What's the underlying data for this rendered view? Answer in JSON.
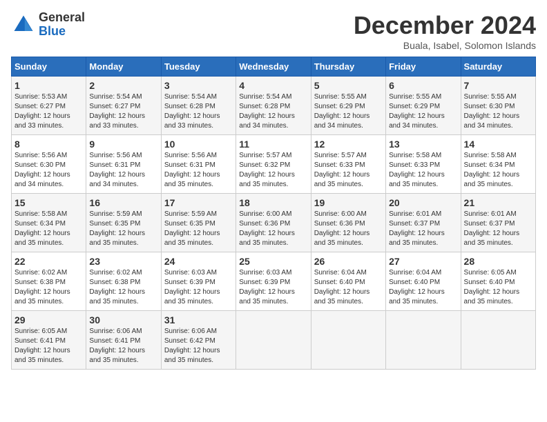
{
  "logo": {
    "general": "General",
    "blue": "Blue"
  },
  "title": "December 2024",
  "subtitle": "Buala, Isabel, Solomon Islands",
  "days_of_week": [
    "Sunday",
    "Monday",
    "Tuesday",
    "Wednesday",
    "Thursday",
    "Friday",
    "Saturday"
  ],
  "weeks": [
    [
      {
        "day": "1",
        "info": "Sunrise: 5:53 AM\nSunset: 6:27 PM\nDaylight: 12 hours\nand 33 minutes."
      },
      {
        "day": "2",
        "info": "Sunrise: 5:54 AM\nSunset: 6:27 PM\nDaylight: 12 hours\nand 33 minutes."
      },
      {
        "day": "3",
        "info": "Sunrise: 5:54 AM\nSunset: 6:28 PM\nDaylight: 12 hours\nand 33 minutes."
      },
      {
        "day": "4",
        "info": "Sunrise: 5:54 AM\nSunset: 6:28 PM\nDaylight: 12 hours\nand 34 minutes."
      },
      {
        "day": "5",
        "info": "Sunrise: 5:55 AM\nSunset: 6:29 PM\nDaylight: 12 hours\nand 34 minutes."
      },
      {
        "day": "6",
        "info": "Sunrise: 5:55 AM\nSunset: 6:29 PM\nDaylight: 12 hours\nand 34 minutes."
      },
      {
        "day": "7",
        "info": "Sunrise: 5:55 AM\nSunset: 6:30 PM\nDaylight: 12 hours\nand 34 minutes."
      }
    ],
    [
      {
        "day": "8",
        "info": "Sunrise: 5:56 AM\nSunset: 6:30 PM\nDaylight: 12 hours\nand 34 minutes."
      },
      {
        "day": "9",
        "info": "Sunrise: 5:56 AM\nSunset: 6:31 PM\nDaylight: 12 hours\nand 34 minutes."
      },
      {
        "day": "10",
        "info": "Sunrise: 5:56 AM\nSunset: 6:31 PM\nDaylight: 12 hours\nand 35 minutes."
      },
      {
        "day": "11",
        "info": "Sunrise: 5:57 AM\nSunset: 6:32 PM\nDaylight: 12 hours\nand 35 minutes."
      },
      {
        "day": "12",
        "info": "Sunrise: 5:57 AM\nSunset: 6:33 PM\nDaylight: 12 hours\nand 35 minutes."
      },
      {
        "day": "13",
        "info": "Sunrise: 5:58 AM\nSunset: 6:33 PM\nDaylight: 12 hours\nand 35 minutes."
      },
      {
        "day": "14",
        "info": "Sunrise: 5:58 AM\nSunset: 6:34 PM\nDaylight: 12 hours\nand 35 minutes."
      }
    ],
    [
      {
        "day": "15",
        "info": "Sunrise: 5:58 AM\nSunset: 6:34 PM\nDaylight: 12 hours\nand 35 minutes."
      },
      {
        "day": "16",
        "info": "Sunrise: 5:59 AM\nSunset: 6:35 PM\nDaylight: 12 hours\nand 35 minutes."
      },
      {
        "day": "17",
        "info": "Sunrise: 5:59 AM\nSunset: 6:35 PM\nDaylight: 12 hours\nand 35 minutes."
      },
      {
        "day": "18",
        "info": "Sunrise: 6:00 AM\nSunset: 6:36 PM\nDaylight: 12 hours\nand 35 minutes."
      },
      {
        "day": "19",
        "info": "Sunrise: 6:00 AM\nSunset: 6:36 PM\nDaylight: 12 hours\nand 35 minutes."
      },
      {
        "day": "20",
        "info": "Sunrise: 6:01 AM\nSunset: 6:37 PM\nDaylight: 12 hours\nand 35 minutes."
      },
      {
        "day": "21",
        "info": "Sunrise: 6:01 AM\nSunset: 6:37 PM\nDaylight: 12 hours\nand 35 minutes."
      }
    ],
    [
      {
        "day": "22",
        "info": "Sunrise: 6:02 AM\nSunset: 6:38 PM\nDaylight: 12 hours\nand 35 minutes."
      },
      {
        "day": "23",
        "info": "Sunrise: 6:02 AM\nSunset: 6:38 PM\nDaylight: 12 hours\nand 35 minutes."
      },
      {
        "day": "24",
        "info": "Sunrise: 6:03 AM\nSunset: 6:39 PM\nDaylight: 12 hours\nand 35 minutes."
      },
      {
        "day": "25",
        "info": "Sunrise: 6:03 AM\nSunset: 6:39 PM\nDaylight: 12 hours\nand 35 minutes."
      },
      {
        "day": "26",
        "info": "Sunrise: 6:04 AM\nSunset: 6:40 PM\nDaylight: 12 hours\nand 35 minutes."
      },
      {
        "day": "27",
        "info": "Sunrise: 6:04 AM\nSunset: 6:40 PM\nDaylight: 12 hours\nand 35 minutes."
      },
      {
        "day": "28",
        "info": "Sunrise: 6:05 AM\nSunset: 6:40 PM\nDaylight: 12 hours\nand 35 minutes."
      }
    ],
    [
      {
        "day": "29",
        "info": "Sunrise: 6:05 AM\nSunset: 6:41 PM\nDaylight: 12 hours\nand 35 minutes."
      },
      {
        "day": "30",
        "info": "Sunrise: 6:06 AM\nSunset: 6:41 PM\nDaylight: 12 hours\nand 35 minutes."
      },
      {
        "day": "31",
        "info": "Sunrise: 6:06 AM\nSunset: 6:42 PM\nDaylight: 12 hours\nand 35 minutes."
      },
      null,
      null,
      null,
      null
    ]
  ]
}
